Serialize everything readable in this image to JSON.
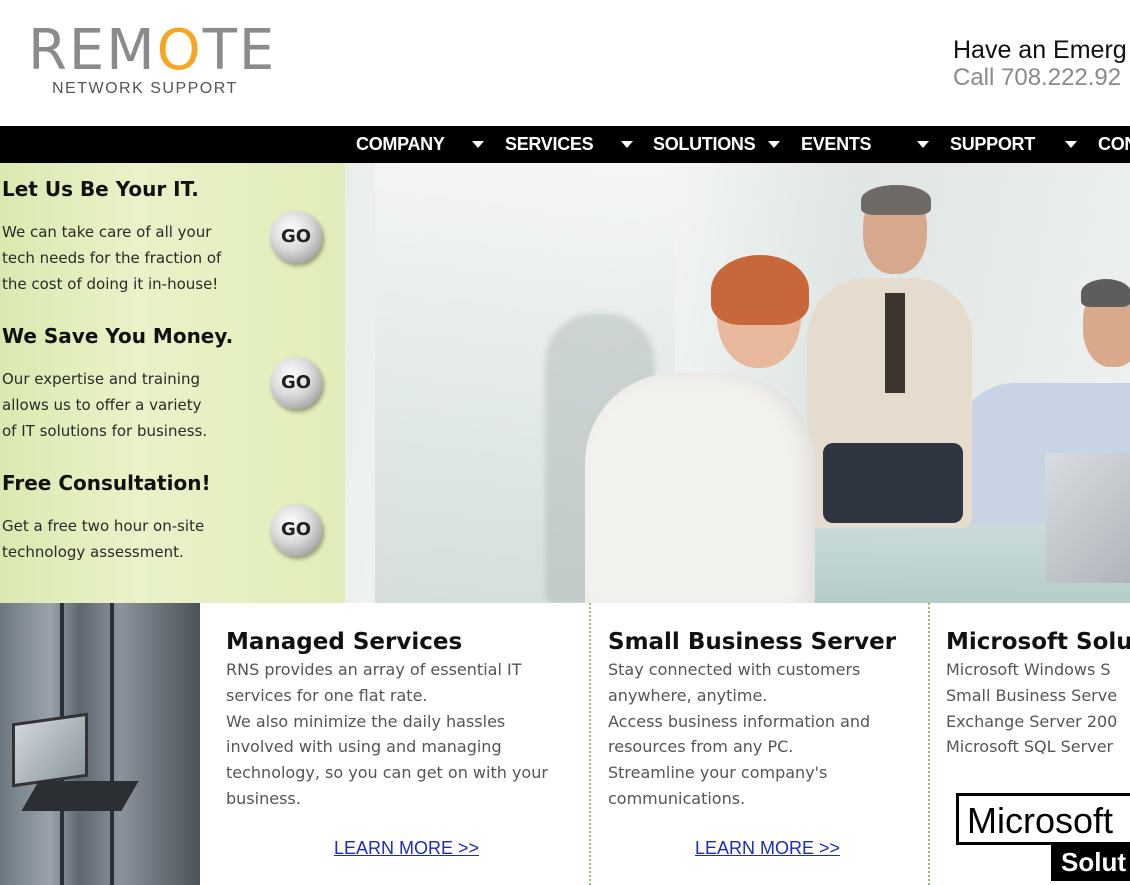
{
  "header": {
    "logo_text_pre": "REM",
    "logo_text_o": "O",
    "logo_text_post": "TE",
    "logo_subtitle": "NETWORK SUPPORT",
    "emergency_line1": "Have an Emerg",
    "emergency_line2": "Call 708.222.92"
  },
  "nav": {
    "items": [
      {
        "label": "COMPANY"
      },
      {
        "label": "SERVICES"
      },
      {
        "label": "SOLUTIONS"
      },
      {
        "label": "EVENTS"
      },
      {
        "label": "SUPPORT"
      },
      {
        "label": "CON"
      }
    ]
  },
  "promos": [
    {
      "title": "Let Us Be Your IT.",
      "lines": [
        "We can take care of all your",
        "tech needs for the fraction of",
        "the cost of doing it in-house!"
      ],
      "button": "GO"
    },
    {
      "title": "We Save You Money.",
      "lines": [
        "Our expertise and training",
        "allows us to offer a variety",
        "of IT solutions for business."
      ],
      "button": "GO"
    },
    {
      "title": "Free Consultation!",
      "lines": [
        "Get a free two hour on-site",
        "technology assessment."
      ],
      "button": "GO"
    }
  ],
  "services": [
    {
      "title": "Managed Services",
      "lines": [
        "RNS provides an array of essential IT",
        "services for one flat rate.",
        "We also minimize the daily hassles",
        "involved with using and managing",
        "technology, so you can get on with your",
        "business."
      ],
      "link": "LEARN MORE >>"
    },
    {
      "title": "Small Business Server",
      "lines": [
        "Stay connected with customers",
        "anywhere, anytime.",
        "Access business information and",
        "resources from any PC.",
        "Streamline your company's",
        "communications."
      ],
      "link": "LEARN MORE >>"
    },
    {
      "title": "Microsoft Solu",
      "lines": [
        "Microsoft Windows S",
        "Small Business Serve",
        "Exchange Server 200",
        "Microsoft SQL Server"
      ]
    }
  ],
  "ms_logo": {
    "word": "Microsoft",
    "bar_word": "Solut"
  },
  "colors": {
    "accent_orange": "#f5a623",
    "nav_bg": "#000000",
    "promo_bg": "#e3eebd",
    "link_blue": "#1d2cb8"
  }
}
